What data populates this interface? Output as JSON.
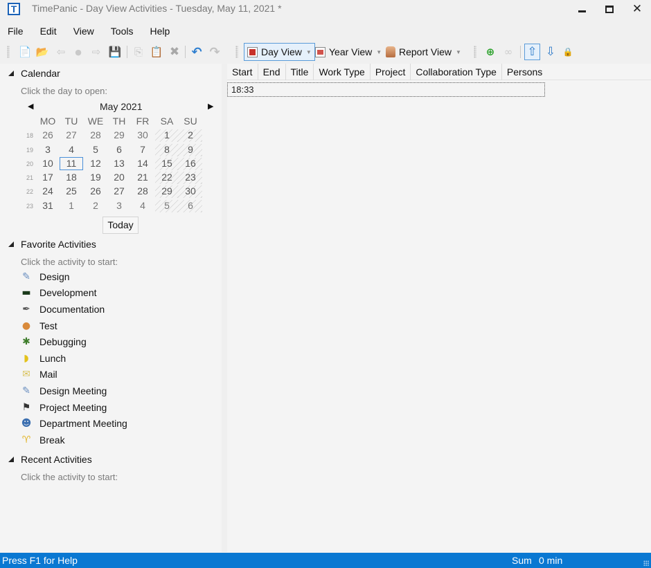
{
  "window": {
    "title": "TimePanic - Day View Activities - Tuesday, May 11, 2021 *",
    "app_icon_letter": "T",
    "minimize_glyph": "minimize",
    "maximize_glyph": "maximize",
    "close_glyph": "✕"
  },
  "menu": [
    "File",
    "Edit",
    "View",
    "Tools",
    "Help"
  ],
  "toolbar": {
    "file_buttons": [
      {
        "name": "new-icon",
        "glyph": "📄"
      },
      {
        "name": "open-folder-icon",
        "glyph": "📂"
      },
      {
        "name": "back-arrow-icon",
        "glyph": "⇦"
      },
      {
        "name": "record-dot-icon",
        "glyph": "●"
      },
      {
        "name": "forward-arrow-icon",
        "glyph": "⇨"
      },
      {
        "name": "save-icon",
        "glyph": "💾"
      }
    ],
    "edit_buttons": [
      {
        "name": "copy-icon",
        "glyph": "⎘"
      },
      {
        "name": "paste-icon",
        "glyph": "📋"
      },
      {
        "name": "delete-icon",
        "glyph": "✖"
      }
    ],
    "history_buttons": [
      {
        "name": "undo-icon",
        "glyph": "↶"
      },
      {
        "name": "redo-icon",
        "glyph": "↷"
      }
    ],
    "views": [
      {
        "label": "Day View",
        "active": true
      },
      {
        "label": "Year View",
        "active": false
      },
      {
        "label": "Report View",
        "active": false
      }
    ],
    "activity_buttons": [
      {
        "name": "add-activity-icon",
        "glyph": "⊕"
      },
      {
        "name": "link-icon",
        "glyph": "∞"
      },
      {
        "name": "move-up-icon",
        "glyph": "⇧"
      },
      {
        "name": "move-down-icon",
        "glyph": "⇩"
      },
      {
        "name": "lock-icon",
        "glyph": "🔒"
      }
    ]
  },
  "calendar": {
    "section_label": "Calendar",
    "hint": "Click the day to open:",
    "month_label": "May 2021",
    "prev_glyph": "◀",
    "next_glyph": "▶",
    "weekdays": [
      "MO",
      "TU",
      "WE",
      "TH",
      "FR",
      "SA",
      "SU"
    ],
    "weeks": [
      {
        "number": "18",
        "days": [
          "26",
          "27",
          "28",
          "29",
          "30",
          "1",
          "2"
        ]
      },
      {
        "number": "19",
        "days": [
          "3",
          "4",
          "5",
          "6",
          "7",
          "8",
          "9"
        ]
      },
      {
        "number": "20",
        "days": [
          "10",
          "11",
          "12",
          "13",
          "14",
          "15",
          "16"
        ]
      },
      {
        "number": "21",
        "days": [
          "17",
          "18",
          "19",
          "20",
          "21",
          "22",
          "23"
        ]
      },
      {
        "number": "22",
        "days": [
          "24",
          "25",
          "26",
          "27",
          "28",
          "29",
          "30"
        ]
      },
      {
        "number": "23",
        "days": [
          "31",
          "1",
          "2",
          "3",
          "4",
          "5",
          "6"
        ]
      }
    ],
    "selected_day": "11",
    "today_label": "Today"
  },
  "favorites": {
    "section_label": "Favorite Activities",
    "hint": "Click the activity to start:",
    "items": [
      {
        "label": "Design",
        "icon": "design-icon",
        "glyph": "✎",
        "color": "#6a8fc0"
      },
      {
        "label": "Development",
        "icon": "terminal-icon",
        "glyph": "▬",
        "color": "#1b3a1b"
      },
      {
        "label": "Documentation",
        "icon": "pen-icon",
        "glyph": "✒",
        "color": "#555555"
      },
      {
        "label": "Test",
        "icon": "person-icon",
        "glyph": "●",
        "color": "#d98a3b"
      },
      {
        "label": "Debugging",
        "icon": "bug-icon",
        "glyph": "✱",
        "color": "#3e7d2b"
      },
      {
        "label": "Lunch",
        "icon": "banana-icon",
        "glyph": "◗",
        "color": "#e3c21c"
      },
      {
        "label": "Mail",
        "icon": "mail-icon",
        "glyph": "✉",
        "color": "#d9c25a"
      },
      {
        "label": "Design Meeting",
        "icon": "design-icon",
        "glyph": "✎",
        "color": "#6a8fc0"
      },
      {
        "label": "Project Meeting",
        "icon": "checkered-flag-icon",
        "glyph": "⚑",
        "color": "#333333"
      },
      {
        "label": "Department Meeting",
        "icon": "people-icon",
        "glyph": "☻",
        "color": "#3b6fb0"
      },
      {
        "label": "Break",
        "icon": "drink-icon",
        "glyph": "♈",
        "color": "#e1b21f"
      }
    ]
  },
  "recent": {
    "section_label": "Recent Activities",
    "hint": "Click the activity to start:"
  },
  "grid": {
    "columns": [
      "Start",
      "End",
      "Title",
      "Work Type",
      "Project",
      "Collaboration Type",
      "Persons"
    ],
    "rows": [
      {
        "start": "18:33"
      }
    ]
  },
  "status": {
    "help": "Press F1 for Help",
    "sum_label": "Sum",
    "sum_value": "0 min"
  }
}
